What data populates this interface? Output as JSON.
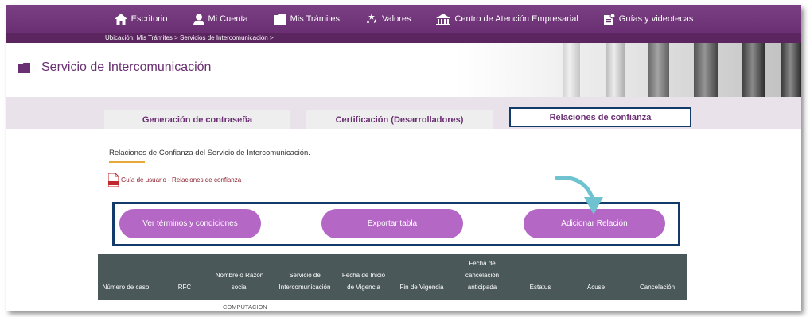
{
  "nav": {
    "items": [
      {
        "label": "Escritorio",
        "icon": "home-icon"
      },
      {
        "label": "Mi Cuenta",
        "icon": "user-icon"
      },
      {
        "label": "Mis Trámites",
        "icon": "folder-icon"
      },
      {
        "label": "Valores",
        "icon": "stars-icon"
      },
      {
        "label": "Centro de Atención Empresarial",
        "icon": "building-icon"
      },
      {
        "label": "Guías y videotecas",
        "icon": "guide-icon"
      }
    ]
  },
  "location": "Ubicación: Mis Trámites > Servicios de Intercomunicación >",
  "banner": {
    "title": "Servicio de Intercomunicación"
  },
  "tabs": [
    {
      "label": "Generación de contraseña",
      "active": false
    },
    {
      "label": "Certificación (Desarrolladores)",
      "active": false
    },
    {
      "label": "Relaciones de confianza",
      "active": true
    }
  ],
  "content": {
    "title": "Relaciones de Confianza del Servicio de Intercomunicación.",
    "pdf_link": "Guía de usuario - Relaciones de confianza"
  },
  "buttons": {
    "terms": "Ver términos y condiciones",
    "export": "Exportar tabla",
    "add": "Adicionar Relación"
  },
  "table": {
    "columns": [
      "Número de caso",
      "RFC",
      "Nombre o Razón social",
      "Servicio de Intercomunicación",
      "Fecha de Inicio de Vigencia",
      "Fin de Vigencia",
      "Fecha de cancelación anticipada",
      "Estatus",
      "Acuse",
      "Cancelación"
    ],
    "first_row_partial": "COMPUTACION"
  },
  "colors": {
    "nav_bg": "#6a2f72",
    "accent_purple": "#b567c6",
    "highlight_border": "#123b6c",
    "table_header": "#4a5859",
    "arrow": "#6fc3d1"
  }
}
